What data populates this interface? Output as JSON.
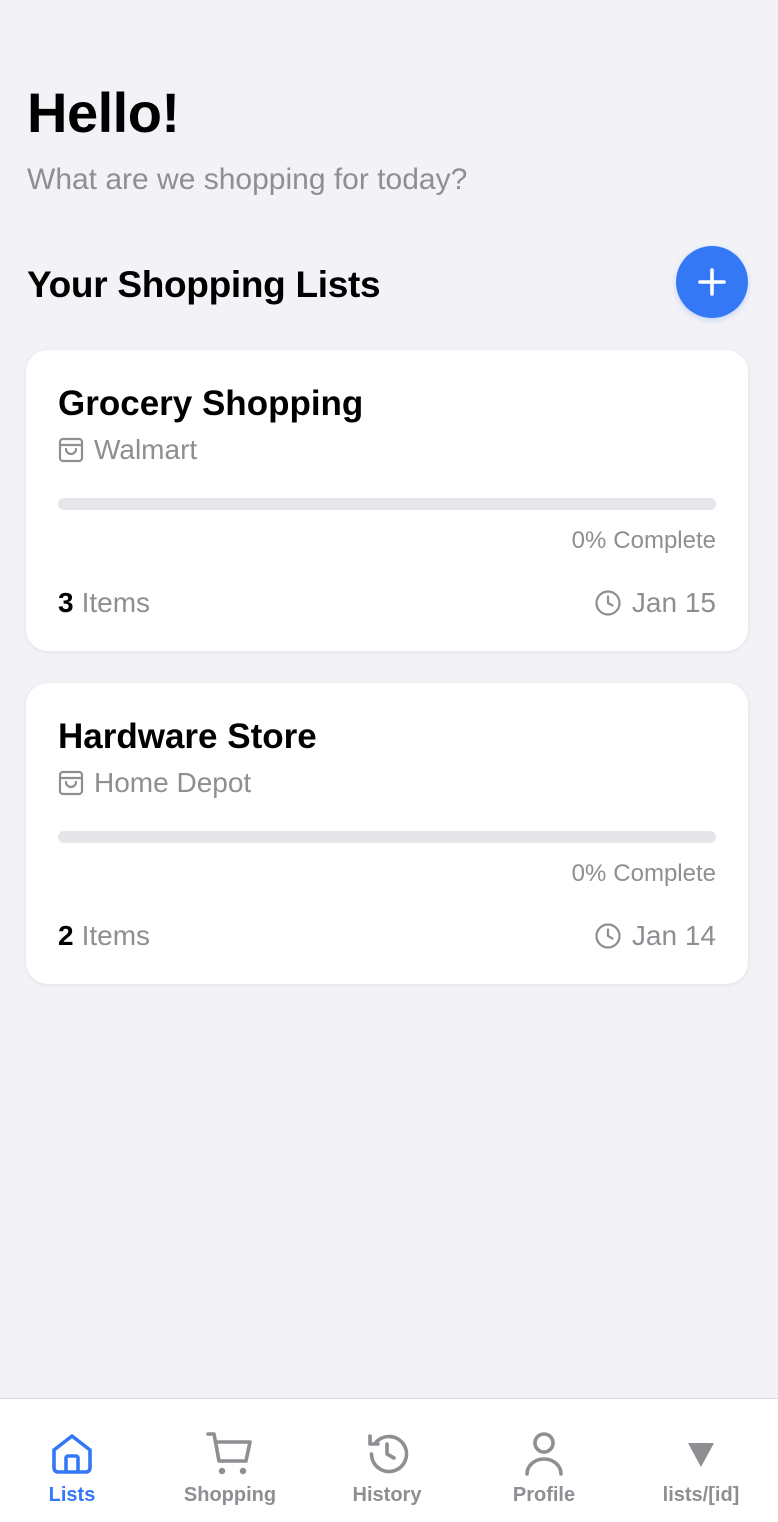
{
  "header": {
    "greeting": "Hello!",
    "subtitle": "What are we shopping for today?"
  },
  "section": {
    "title": "Your Shopping Lists",
    "add_icon": "plus-icon"
  },
  "lists": [
    {
      "name": "Grocery Shopping",
      "store": "Walmart",
      "progress": 0,
      "complete_pct": "0%",
      "complete_label": "Complete",
      "item_count": "3",
      "item_unit": "Items",
      "date": "Jan 15"
    },
    {
      "name": "Hardware Store",
      "store": "Home Depot",
      "progress": 0,
      "complete_pct": "0%",
      "complete_label": "Complete",
      "item_count": "2",
      "item_unit": "Items",
      "date": "Jan 14"
    }
  ],
  "tabs": [
    {
      "label": "Lists",
      "icon": "home-icon",
      "active": true
    },
    {
      "label": "Shopping",
      "icon": "cart-icon",
      "active": false
    },
    {
      "label": "History",
      "icon": "history-icon",
      "active": false
    },
    {
      "label": "Profile",
      "icon": "person-icon",
      "active": false
    },
    {
      "label": "lists/[id]",
      "icon": "triangle-down-icon",
      "active": false
    }
  ],
  "colors": {
    "accent": "#3478f6",
    "background": "#f2f2f7",
    "secondary_text": "#8e8e93",
    "track": "#e5e5ea"
  }
}
